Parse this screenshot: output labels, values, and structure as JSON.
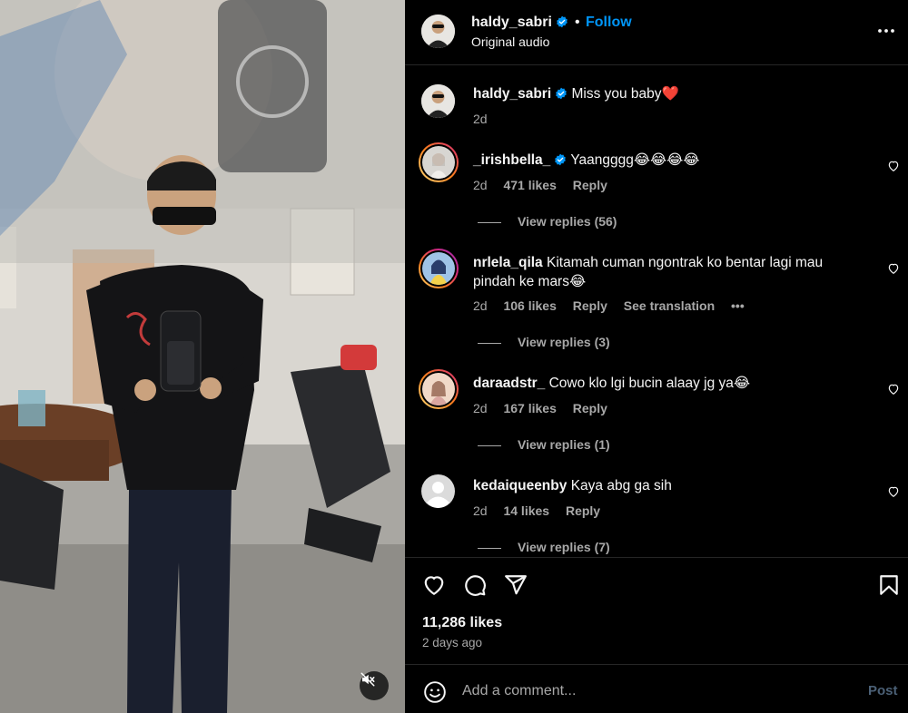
{
  "post": {
    "username": "haldy_sabri",
    "dot": "•",
    "follow_label": "Follow",
    "audio": "Original audio",
    "verified_icon": "verified-badge-icon",
    "caption": {
      "username": "haldy_sabri",
      "text": "Miss you baby❤️",
      "time": "2d"
    }
  },
  "comments": [
    {
      "username": "_irishbella_",
      "verified": true,
      "text": "Yaangggg😂😂😂😂",
      "time": "2d",
      "likes": "471 likes",
      "reply": "Reply",
      "view_replies": "View replies (56)"
    },
    {
      "username": "nrlela_qila",
      "verified": false,
      "text": "Kitamah cuman ngontrak ko bentar lagi mau pindah ke mars😂",
      "time": "2d",
      "likes": "106 likes",
      "reply": "Reply",
      "translation": "See translation",
      "more": "•••",
      "view_replies": "View replies (3)"
    },
    {
      "username": "daraadstr_",
      "verified": false,
      "text": "Cowo klo lgi bucin alaay jg ya😂",
      "time": "2d",
      "likes": "167 likes",
      "reply": "Reply",
      "view_replies": "View replies (1)"
    },
    {
      "username": "kedaiqueenby",
      "verified": false,
      "text": "Kaya abg ga sih",
      "time": "2d",
      "likes": "14 likes",
      "reply": "Reply",
      "view_replies": "View replies (7)"
    }
  ],
  "footer": {
    "likes": "11,286 likes",
    "ago": "2 days ago",
    "comment_placeholder": "Add a comment...",
    "post_label": "Post"
  },
  "colors": {
    "accent": "#0095f6",
    "verified": "#0095f6",
    "story_ring_start": "#feda75",
    "story_ring_end": "#d62976",
    "muted_text": "#a8a8a8"
  }
}
